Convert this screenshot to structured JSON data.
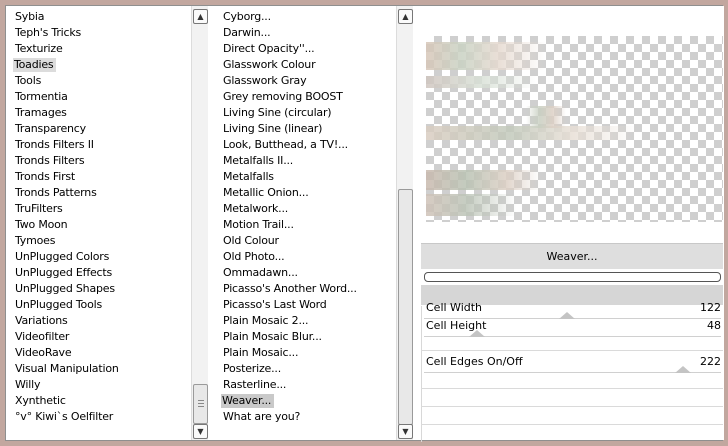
{
  "categories": [
    "Sybia",
    "Teph's Tricks",
    "Texturize",
    "Toadies",
    "Tools",
    "Tormentia",
    "Tramages",
    "Transparency",
    "Tronds Filters II",
    "Tronds Filters",
    "Tronds First",
    "Tronds Patterns",
    "TruFilters",
    "Two Moon",
    "Tymoes",
    "UnPlugged Colors",
    "UnPlugged Effects",
    "UnPlugged Shapes",
    "UnPlugged Tools",
    "Variations",
    "Videofilter",
    "VideoRave",
    "Visual Manipulation",
    "Willy",
    "Xynthetic",
    "°v° Kiwi`s Oelfilter"
  ],
  "filters": [
    "Cyborg...",
    "Darwin...",
    "Direct Opacity''...",
    "Glasswork Colour",
    "Glasswork Gray",
    "Grey removing BOOST",
    "Living Sine (circular)",
    "Living Sine (linear)",
    "Look, Butthead, a TV!...",
    "Metalfalls II...",
    "Metalfalls",
    "Metallic Onion...",
    "Metalwork...",
    "Motion Trail...",
    "Old Colour",
    "Old Photo...",
    "Ommadawn...",
    "Picasso's Another Word...",
    "Picasso's Last Word",
    "Plain Mosaic 2...",
    "Plain Mosaic Blur...",
    "Plain Mosaic...",
    "Posterize...",
    "Rasterline...",
    "Weaver...",
    "What are you?"
  ],
  "selected_category": "Toadies",
  "selected_filter": "Weaver...",
  "plugin_button_label": "Weaver...",
  "progress": 0,
  "params": [
    {
      "label": "Cell Width",
      "value": "122"
    },
    {
      "label": "Cell Height",
      "value": "48"
    },
    {
      "label": "Cell Edges On/Off",
      "value": "222"
    }
  ],
  "colors": {
    "window_bg": "#c2a79f",
    "selection": "#dcdcdc",
    "checker": "#cfcfcf"
  },
  "icons": {
    "scroll_up": "▲",
    "scroll_down": "▼"
  }
}
